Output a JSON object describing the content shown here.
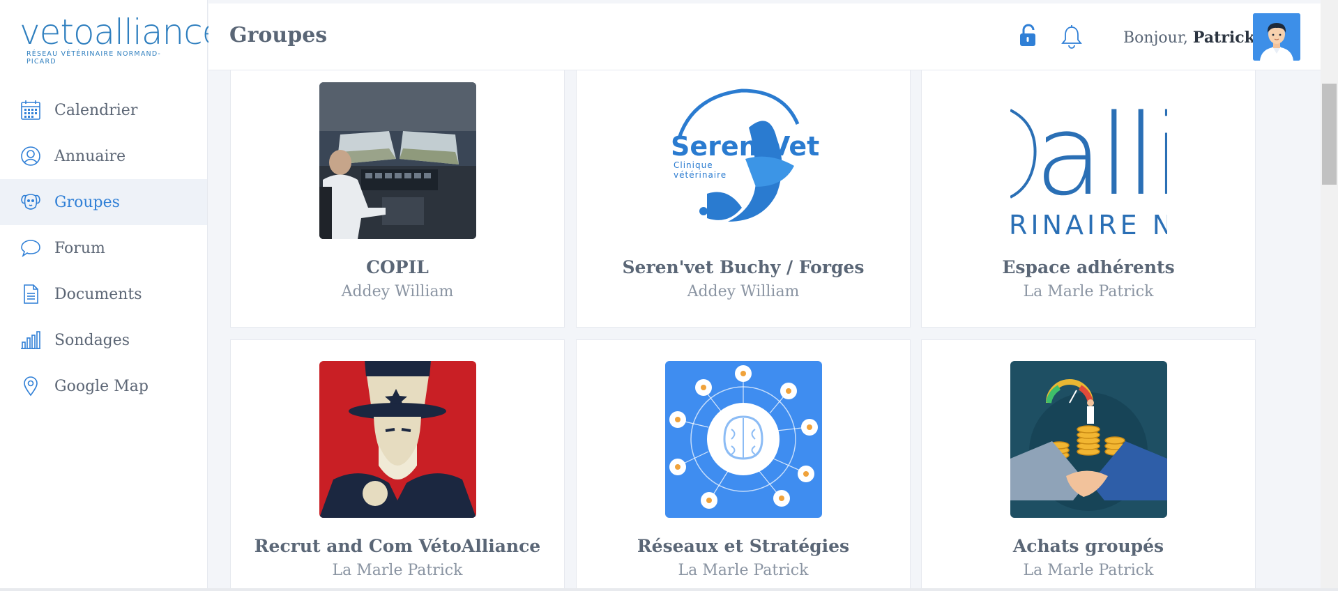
{
  "brand": {
    "wordmark": "vetoalliance",
    "tagline": "RÉSEAU VÉTÉRINAIRE NORMAND-PICARD",
    "color": "#2f7fbf"
  },
  "sidebar": {
    "items": [
      {
        "label": "Calendrier",
        "icon": "calendar-icon",
        "active": false
      },
      {
        "label": "Annuaire",
        "icon": "user-circle-icon",
        "active": false
      },
      {
        "label": "Groupes",
        "icon": "dog-face-icon",
        "active": true
      },
      {
        "label": "Forum",
        "icon": "speech-bubble-icon",
        "active": false
      },
      {
        "label": "Documents",
        "icon": "document-icon",
        "active": false
      },
      {
        "label": "Sondages",
        "icon": "bar-chart-icon",
        "active": false
      },
      {
        "label": "Google Map",
        "icon": "map-pin-icon",
        "active": false
      }
    ]
  },
  "header": {
    "title": "Groupes",
    "greeting_prefix": "Bonjour, ",
    "user_name": "Patrick",
    "lock_icon": "unlock-icon",
    "bell_icon": "bell-icon"
  },
  "groups": [
    {
      "title": "COPIL",
      "owner": "Addey William",
      "image": "cockpit-photo"
    },
    {
      "title": "Seren'vet Buchy / Forges",
      "owner": "Addey William",
      "image": "serenvet-logo",
      "logo_text": "Seren",
      "logo_text2": "Vet",
      "logo_sub1": "Clinique",
      "logo_sub2": "vétérinaire"
    },
    {
      "title": "Espace adhérents",
      "owner": "La Marle Patrick",
      "image": "vetoalliance-logo-crop",
      "logo_text": "alli",
      "logo_sub": "RINAIRE NO"
    },
    {
      "title": "Recrut and Com VétoAlliance",
      "owner": "La Marle Patrick",
      "image": "uncle-sam-poster"
    },
    {
      "title": "Réseaux et Stratégies",
      "owner": "La Marle Patrick",
      "image": "brain-network-illustration"
    },
    {
      "title": "Achats groupés",
      "owner": "La Marle Patrick",
      "image": "handshake-coins-illustration"
    }
  ],
  "colors": {
    "accent": "#2f7fd6",
    "sidebar_active_bg": "#eef2f8",
    "page_bg": "#f3f5f9"
  }
}
